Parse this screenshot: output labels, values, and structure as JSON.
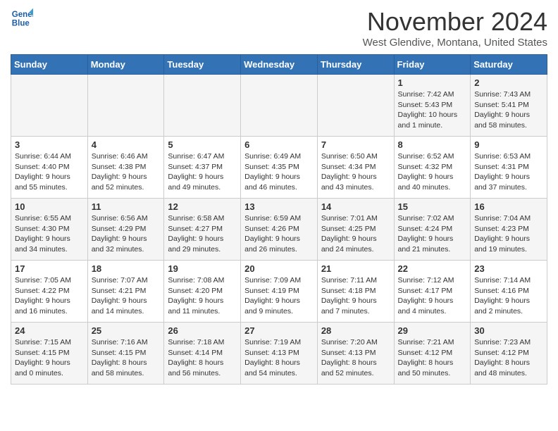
{
  "logo": {
    "line1": "General",
    "line2": "Blue"
  },
  "header": {
    "month": "November 2024",
    "location": "West Glendive, Montana, United States"
  },
  "weekdays": [
    "Sunday",
    "Monday",
    "Tuesday",
    "Wednesday",
    "Thursday",
    "Friday",
    "Saturday"
  ],
  "weeks": [
    [
      {
        "day": "",
        "info": ""
      },
      {
        "day": "",
        "info": ""
      },
      {
        "day": "",
        "info": ""
      },
      {
        "day": "",
        "info": ""
      },
      {
        "day": "",
        "info": ""
      },
      {
        "day": "1",
        "info": "Sunrise: 7:42 AM\nSunset: 5:43 PM\nDaylight: 10 hours\nand 1 minute."
      },
      {
        "day": "2",
        "info": "Sunrise: 7:43 AM\nSunset: 5:41 PM\nDaylight: 9 hours\nand 58 minutes."
      }
    ],
    [
      {
        "day": "3",
        "info": "Sunrise: 6:44 AM\nSunset: 4:40 PM\nDaylight: 9 hours\nand 55 minutes."
      },
      {
        "day": "4",
        "info": "Sunrise: 6:46 AM\nSunset: 4:38 PM\nDaylight: 9 hours\nand 52 minutes."
      },
      {
        "day": "5",
        "info": "Sunrise: 6:47 AM\nSunset: 4:37 PM\nDaylight: 9 hours\nand 49 minutes."
      },
      {
        "day": "6",
        "info": "Sunrise: 6:49 AM\nSunset: 4:35 PM\nDaylight: 9 hours\nand 46 minutes."
      },
      {
        "day": "7",
        "info": "Sunrise: 6:50 AM\nSunset: 4:34 PM\nDaylight: 9 hours\nand 43 minutes."
      },
      {
        "day": "8",
        "info": "Sunrise: 6:52 AM\nSunset: 4:32 PM\nDaylight: 9 hours\nand 40 minutes."
      },
      {
        "day": "9",
        "info": "Sunrise: 6:53 AM\nSunset: 4:31 PM\nDaylight: 9 hours\nand 37 minutes."
      }
    ],
    [
      {
        "day": "10",
        "info": "Sunrise: 6:55 AM\nSunset: 4:30 PM\nDaylight: 9 hours\nand 34 minutes."
      },
      {
        "day": "11",
        "info": "Sunrise: 6:56 AM\nSunset: 4:29 PM\nDaylight: 9 hours\nand 32 minutes."
      },
      {
        "day": "12",
        "info": "Sunrise: 6:58 AM\nSunset: 4:27 PM\nDaylight: 9 hours\nand 29 minutes."
      },
      {
        "day": "13",
        "info": "Sunrise: 6:59 AM\nSunset: 4:26 PM\nDaylight: 9 hours\nand 26 minutes."
      },
      {
        "day": "14",
        "info": "Sunrise: 7:01 AM\nSunset: 4:25 PM\nDaylight: 9 hours\nand 24 minutes."
      },
      {
        "day": "15",
        "info": "Sunrise: 7:02 AM\nSunset: 4:24 PM\nDaylight: 9 hours\nand 21 minutes."
      },
      {
        "day": "16",
        "info": "Sunrise: 7:04 AM\nSunset: 4:23 PM\nDaylight: 9 hours\nand 19 minutes."
      }
    ],
    [
      {
        "day": "17",
        "info": "Sunrise: 7:05 AM\nSunset: 4:22 PM\nDaylight: 9 hours\nand 16 minutes."
      },
      {
        "day": "18",
        "info": "Sunrise: 7:07 AM\nSunset: 4:21 PM\nDaylight: 9 hours\nand 14 minutes."
      },
      {
        "day": "19",
        "info": "Sunrise: 7:08 AM\nSunset: 4:20 PM\nDaylight: 9 hours\nand 11 minutes."
      },
      {
        "day": "20",
        "info": "Sunrise: 7:09 AM\nSunset: 4:19 PM\nDaylight: 9 hours\nand 9 minutes."
      },
      {
        "day": "21",
        "info": "Sunrise: 7:11 AM\nSunset: 4:18 PM\nDaylight: 9 hours\nand 7 minutes."
      },
      {
        "day": "22",
        "info": "Sunrise: 7:12 AM\nSunset: 4:17 PM\nDaylight: 9 hours\nand 4 minutes."
      },
      {
        "day": "23",
        "info": "Sunrise: 7:14 AM\nSunset: 4:16 PM\nDaylight: 9 hours\nand 2 minutes."
      }
    ],
    [
      {
        "day": "24",
        "info": "Sunrise: 7:15 AM\nSunset: 4:15 PM\nDaylight: 9 hours\nand 0 minutes."
      },
      {
        "day": "25",
        "info": "Sunrise: 7:16 AM\nSunset: 4:15 PM\nDaylight: 8 hours\nand 58 minutes."
      },
      {
        "day": "26",
        "info": "Sunrise: 7:18 AM\nSunset: 4:14 PM\nDaylight: 8 hours\nand 56 minutes."
      },
      {
        "day": "27",
        "info": "Sunrise: 7:19 AM\nSunset: 4:13 PM\nDaylight: 8 hours\nand 54 minutes."
      },
      {
        "day": "28",
        "info": "Sunrise: 7:20 AM\nSunset: 4:13 PM\nDaylight: 8 hours\nand 52 minutes."
      },
      {
        "day": "29",
        "info": "Sunrise: 7:21 AM\nSunset: 4:12 PM\nDaylight: 8 hours\nand 50 minutes."
      },
      {
        "day": "30",
        "info": "Sunrise: 7:23 AM\nSunset: 4:12 PM\nDaylight: 8 hours\nand 48 minutes."
      }
    ]
  ]
}
